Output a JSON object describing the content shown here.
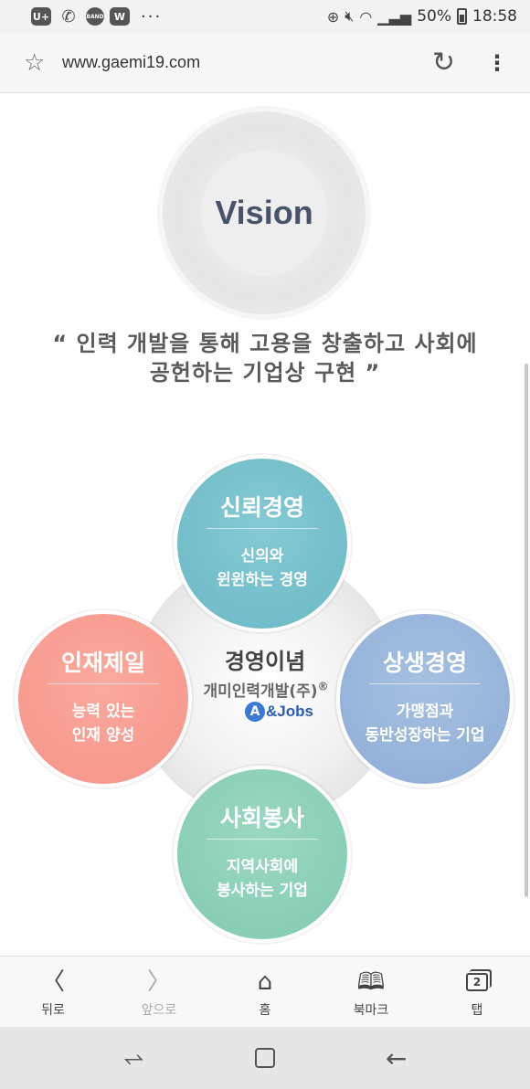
{
  "status_bar": {
    "app_icons": [
      "U+",
      "who",
      "BAND",
      "W"
    ],
    "more": "···",
    "battery": "50%",
    "time": "18:58"
  },
  "browser": {
    "url": "www.gaemi19.com"
  },
  "page": {
    "vision_title": "Vision",
    "quote_line1": "“ 인력 개발을 통해 고용을 창출하고 사회에",
    "quote_line2": "공헌하는 기업상 구현 ”",
    "center": {
      "title": "경영이념",
      "company": "개미인력개발(주)",
      "registered": "®",
      "logo_a": "A",
      "logo_text": "&Jobs"
    },
    "petals": {
      "top": {
        "title": "신뢰경영",
        "line1": "신의와",
        "line2": "윈윈하는 경영",
        "color": "#7ec3ce"
      },
      "left": {
        "title": "인재제일",
        "line1": "능력 있는",
        "line2": "인재 양성",
        "color": "#f9a093"
      },
      "right": {
        "title": "상생경영",
        "line1": "가맹점과",
        "line2": "동반성장하는 기업",
        "color": "#9db9de"
      },
      "bottom": {
        "title": "사회봉사",
        "line1": "지역사회에",
        "line2": "봉사하는 기업",
        "color": "#8fd3b9"
      }
    }
  },
  "bottom_nav": {
    "back": "뒤로",
    "forward": "앞으로",
    "home": "홈",
    "bookmarks": "북마크",
    "tabs": "탭",
    "tab_count": "2"
  }
}
